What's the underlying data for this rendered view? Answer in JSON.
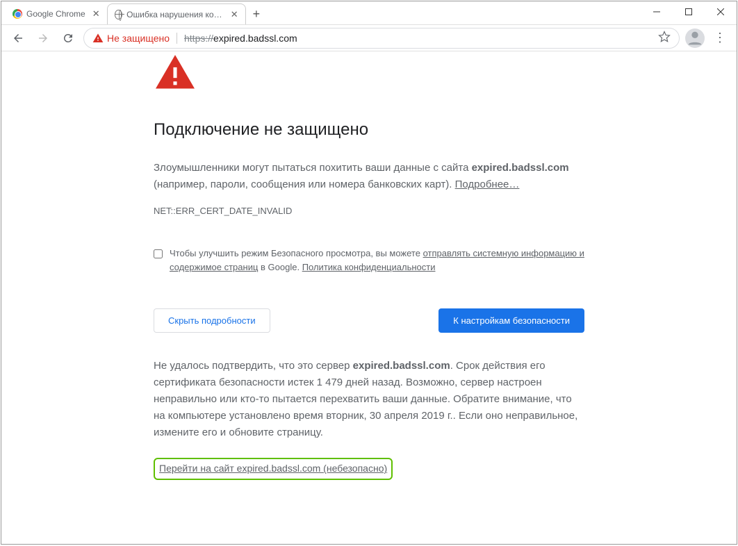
{
  "tabs": [
    {
      "title": "Google Chrome",
      "active": false
    },
    {
      "title": "Ошибка нарушения конфиденц",
      "active": true
    }
  ],
  "security": {
    "label": "Не защищено",
    "https": "https://",
    "url_rest": "expired.badssl.com"
  },
  "page": {
    "heading": "Подключение не защищено",
    "p1_a": "Злоумышленники могут пытаться похитить ваши данные с сайта ",
    "p1_host": "expired.badssl.com",
    "p1_b": " (например, пароли, сообщения или номера банковских карт). ",
    "learn_more": "Подробнее…",
    "err": "NET::ERR_CERT_DATE_INVALID",
    "optin_a": "Чтобы улучшить режим Безопасного просмотра, вы можете ",
    "optin_link": "отправлять системную информацию и содержимое страниц",
    "optin_b": " в Google. ",
    "optin_policy": "Политика конфиденциальности",
    "btn_hide": "Скрыть подробности",
    "btn_safety": "К настройкам безопасности",
    "det_a": "Не удалось подтвердить, что это сервер ",
    "det_host": "expired.badssl.com",
    "det_b": ". Срок действия его сертификата безопасности истек 1 479 дней назад. Возможно, сервер настроен неправильно или кто-то пытается перехватить ваши данные. Обратите внимание, что на компьютере установлено время вторник, 30 апреля 2019 г.. Если оно неправильное, измените его и обновите страницу.",
    "proceed": "Перейти на сайт expired.badssl.com (небезопасно)"
  }
}
